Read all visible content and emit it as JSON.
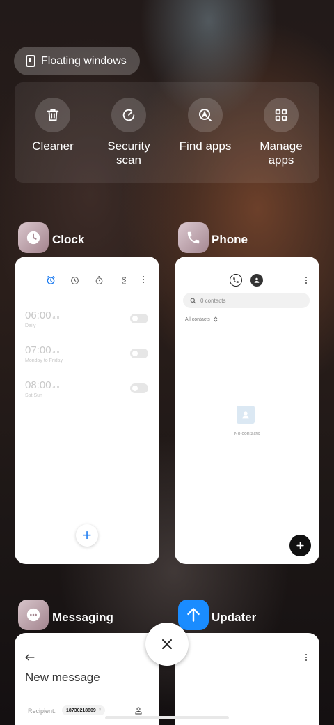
{
  "floating_windows": {
    "label": "Floating windows"
  },
  "quick_actions": [
    {
      "label": "Cleaner",
      "icon": "trash-icon"
    },
    {
      "label": "Security\nscan",
      "icon": "security-scan-icon"
    },
    {
      "label": "Find apps",
      "icon": "find-apps-icon"
    },
    {
      "label": "Manage\napps",
      "icon": "manage-apps-icon"
    }
  ],
  "apps": {
    "clock": {
      "name": "Clock",
      "alarms": [
        {
          "time": "06:00",
          "ampm": "am",
          "repeat": "Daily"
        },
        {
          "time": "07:00",
          "ampm": "am",
          "repeat": "Monday to Friday"
        },
        {
          "time": "08:00",
          "ampm": "am",
          "repeat": "Sat Sun"
        }
      ],
      "fab": "+"
    },
    "phone": {
      "name": "Phone",
      "search_placeholder": "0 contacts",
      "filter": "All contacts",
      "empty_text": "No contacts"
    },
    "messaging": {
      "name": "Messaging",
      "title": "New message",
      "recipient_label": "Recipient:",
      "recipient_value": "18730218809"
    },
    "updater": {
      "name": "Updater"
    }
  },
  "colors": {
    "accent_blue": "#1e7cf0",
    "updater_blue": "#1a8cff"
  }
}
